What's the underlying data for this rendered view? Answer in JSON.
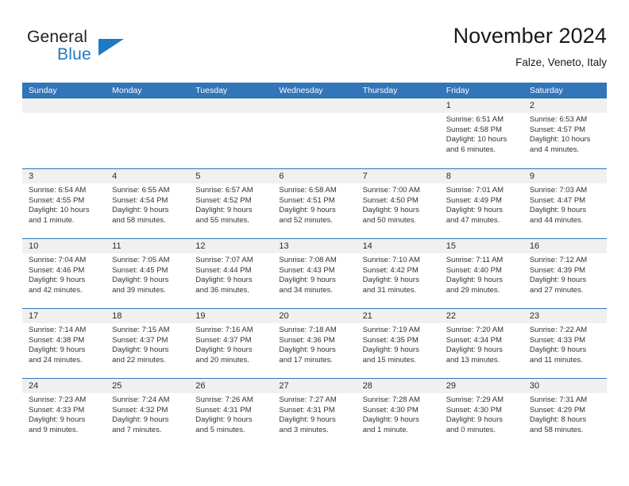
{
  "logo": {
    "word_top": "General",
    "word_bottom": "Blue",
    "triangle_color": "#1f7ac4",
    "text_color": "#231f20"
  },
  "header": {
    "title": "November 2024",
    "subtitle": "Falze, Veneto, Italy"
  },
  "theme": {
    "header_blue": "#3275b8",
    "day_strip_gray": "#f0f0f0",
    "text": "#333333"
  },
  "calendar": {
    "day_headers": [
      "Sunday",
      "Monday",
      "Tuesday",
      "Wednesday",
      "Thursday",
      "Friday",
      "Saturday"
    ],
    "labels": {
      "sunrise": "Sunrise:",
      "sunset": "Sunset:",
      "daylight": "Daylight:"
    },
    "weeks": [
      [
        {
          "day": "",
          "empty": true
        },
        {
          "day": "",
          "empty": true
        },
        {
          "day": "",
          "empty": true
        },
        {
          "day": "",
          "empty": true
        },
        {
          "day": "",
          "empty": true
        },
        {
          "day": "1",
          "sunrise": "Sunrise: 6:51 AM",
          "sunset": "Sunset: 4:58 PM",
          "daylight_1": "Daylight: 10 hours",
          "daylight_2": "and 6 minutes."
        },
        {
          "day": "2",
          "sunrise": "Sunrise: 6:53 AM",
          "sunset": "Sunset: 4:57 PM",
          "daylight_1": "Daylight: 10 hours",
          "daylight_2": "and 4 minutes."
        }
      ],
      [
        {
          "day": "3",
          "sunrise": "Sunrise: 6:54 AM",
          "sunset": "Sunset: 4:55 PM",
          "daylight_1": "Daylight: 10 hours",
          "daylight_2": "and 1 minute."
        },
        {
          "day": "4",
          "sunrise": "Sunrise: 6:55 AM",
          "sunset": "Sunset: 4:54 PM",
          "daylight_1": "Daylight: 9 hours",
          "daylight_2": "and 58 minutes."
        },
        {
          "day": "5",
          "sunrise": "Sunrise: 6:57 AM",
          "sunset": "Sunset: 4:52 PM",
          "daylight_1": "Daylight: 9 hours",
          "daylight_2": "and 55 minutes."
        },
        {
          "day": "6",
          "sunrise": "Sunrise: 6:58 AM",
          "sunset": "Sunset: 4:51 PM",
          "daylight_1": "Daylight: 9 hours",
          "daylight_2": "and 52 minutes."
        },
        {
          "day": "7",
          "sunrise": "Sunrise: 7:00 AM",
          "sunset": "Sunset: 4:50 PM",
          "daylight_1": "Daylight: 9 hours",
          "daylight_2": "and 50 minutes."
        },
        {
          "day": "8",
          "sunrise": "Sunrise: 7:01 AM",
          "sunset": "Sunset: 4:49 PM",
          "daylight_1": "Daylight: 9 hours",
          "daylight_2": "and 47 minutes."
        },
        {
          "day": "9",
          "sunrise": "Sunrise: 7:03 AM",
          "sunset": "Sunset: 4:47 PM",
          "daylight_1": "Daylight: 9 hours",
          "daylight_2": "and 44 minutes."
        }
      ],
      [
        {
          "day": "10",
          "sunrise": "Sunrise: 7:04 AM",
          "sunset": "Sunset: 4:46 PM",
          "daylight_1": "Daylight: 9 hours",
          "daylight_2": "and 42 minutes."
        },
        {
          "day": "11",
          "sunrise": "Sunrise: 7:05 AM",
          "sunset": "Sunset: 4:45 PM",
          "daylight_1": "Daylight: 9 hours",
          "daylight_2": "and 39 minutes."
        },
        {
          "day": "12",
          "sunrise": "Sunrise: 7:07 AM",
          "sunset": "Sunset: 4:44 PM",
          "daylight_1": "Daylight: 9 hours",
          "daylight_2": "and 36 minutes."
        },
        {
          "day": "13",
          "sunrise": "Sunrise: 7:08 AM",
          "sunset": "Sunset: 4:43 PM",
          "daylight_1": "Daylight: 9 hours",
          "daylight_2": "and 34 minutes."
        },
        {
          "day": "14",
          "sunrise": "Sunrise: 7:10 AM",
          "sunset": "Sunset: 4:42 PM",
          "daylight_1": "Daylight: 9 hours",
          "daylight_2": "and 31 minutes."
        },
        {
          "day": "15",
          "sunrise": "Sunrise: 7:11 AM",
          "sunset": "Sunset: 4:40 PM",
          "daylight_1": "Daylight: 9 hours",
          "daylight_2": "and 29 minutes."
        },
        {
          "day": "16",
          "sunrise": "Sunrise: 7:12 AM",
          "sunset": "Sunset: 4:39 PM",
          "daylight_1": "Daylight: 9 hours",
          "daylight_2": "and 27 minutes."
        }
      ],
      [
        {
          "day": "17",
          "sunrise": "Sunrise: 7:14 AM",
          "sunset": "Sunset: 4:38 PM",
          "daylight_1": "Daylight: 9 hours",
          "daylight_2": "and 24 minutes."
        },
        {
          "day": "18",
          "sunrise": "Sunrise: 7:15 AM",
          "sunset": "Sunset: 4:37 PM",
          "daylight_1": "Daylight: 9 hours",
          "daylight_2": "and 22 minutes."
        },
        {
          "day": "19",
          "sunrise": "Sunrise: 7:16 AM",
          "sunset": "Sunset: 4:37 PM",
          "daylight_1": "Daylight: 9 hours",
          "daylight_2": "and 20 minutes."
        },
        {
          "day": "20",
          "sunrise": "Sunrise: 7:18 AM",
          "sunset": "Sunset: 4:36 PM",
          "daylight_1": "Daylight: 9 hours",
          "daylight_2": "and 17 minutes."
        },
        {
          "day": "21",
          "sunrise": "Sunrise: 7:19 AM",
          "sunset": "Sunset: 4:35 PM",
          "daylight_1": "Daylight: 9 hours",
          "daylight_2": "and 15 minutes."
        },
        {
          "day": "22",
          "sunrise": "Sunrise: 7:20 AM",
          "sunset": "Sunset: 4:34 PM",
          "daylight_1": "Daylight: 9 hours",
          "daylight_2": "and 13 minutes."
        },
        {
          "day": "23",
          "sunrise": "Sunrise: 7:22 AM",
          "sunset": "Sunset: 4:33 PM",
          "daylight_1": "Daylight: 9 hours",
          "daylight_2": "and 11 minutes."
        }
      ],
      [
        {
          "day": "24",
          "sunrise": "Sunrise: 7:23 AM",
          "sunset": "Sunset: 4:33 PM",
          "daylight_1": "Daylight: 9 hours",
          "daylight_2": "and 9 minutes."
        },
        {
          "day": "25",
          "sunrise": "Sunrise: 7:24 AM",
          "sunset": "Sunset: 4:32 PM",
          "daylight_1": "Daylight: 9 hours",
          "daylight_2": "and 7 minutes."
        },
        {
          "day": "26",
          "sunrise": "Sunrise: 7:26 AM",
          "sunset": "Sunset: 4:31 PM",
          "daylight_1": "Daylight: 9 hours",
          "daylight_2": "and 5 minutes."
        },
        {
          "day": "27",
          "sunrise": "Sunrise: 7:27 AM",
          "sunset": "Sunset: 4:31 PM",
          "daylight_1": "Daylight: 9 hours",
          "daylight_2": "and 3 minutes."
        },
        {
          "day": "28",
          "sunrise": "Sunrise: 7:28 AM",
          "sunset": "Sunset: 4:30 PM",
          "daylight_1": "Daylight: 9 hours",
          "daylight_2": "and 1 minute."
        },
        {
          "day": "29",
          "sunrise": "Sunrise: 7:29 AM",
          "sunset": "Sunset: 4:30 PM",
          "daylight_1": "Daylight: 9 hours",
          "daylight_2": "and 0 minutes."
        },
        {
          "day": "30",
          "sunrise": "Sunrise: 7:31 AM",
          "sunset": "Sunset: 4:29 PM",
          "daylight_1": "Daylight: 8 hours",
          "daylight_2": "and 58 minutes."
        }
      ]
    ]
  }
}
